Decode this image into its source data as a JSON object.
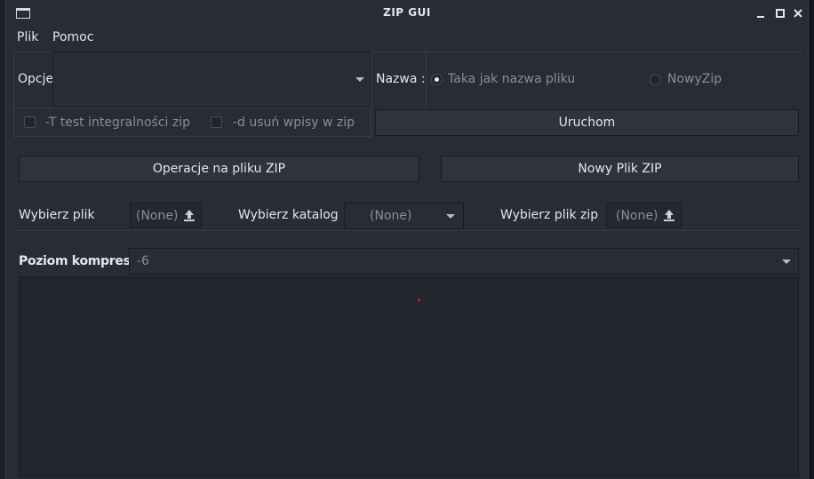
{
  "window": {
    "title": "ZIP GUI"
  },
  "menu": {
    "file": "Plik",
    "help": "Pomoc"
  },
  "options": {
    "label": "Opcje",
    "combo_value": "",
    "name_label": "Nazwa :",
    "radio_same": "Taka jak nazwa pliku",
    "radio_same_checked": true,
    "radio_new": "NowyZip",
    "radio_new_checked": false,
    "check_test": "-T test integralności zip",
    "check_delete": "-d usuń wpisy w  zip",
    "run_button": "Uruchom"
  },
  "actions": {
    "ops_button": "Operacje na pliku ZIP",
    "new_button": "Nowy Plik ZIP"
  },
  "files": {
    "choose_file_label": "Wybierz plik",
    "choose_file_value": "(None)",
    "choose_dir_label": "Wybierz  katalog",
    "choose_dir_value": "(None)",
    "choose_zip_label": "Wybierz  plik zip",
    "choose_zip_value": "(None)"
  },
  "compression": {
    "label": "Poziom kompresji",
    "value": "-6"
  },
  "icons": [
    "window-icon",
    "minimize-icon",
    "maximize-icon",
    "close-icon",
    "upload-icon",
    "chevron-down-icon"
  ]
}
